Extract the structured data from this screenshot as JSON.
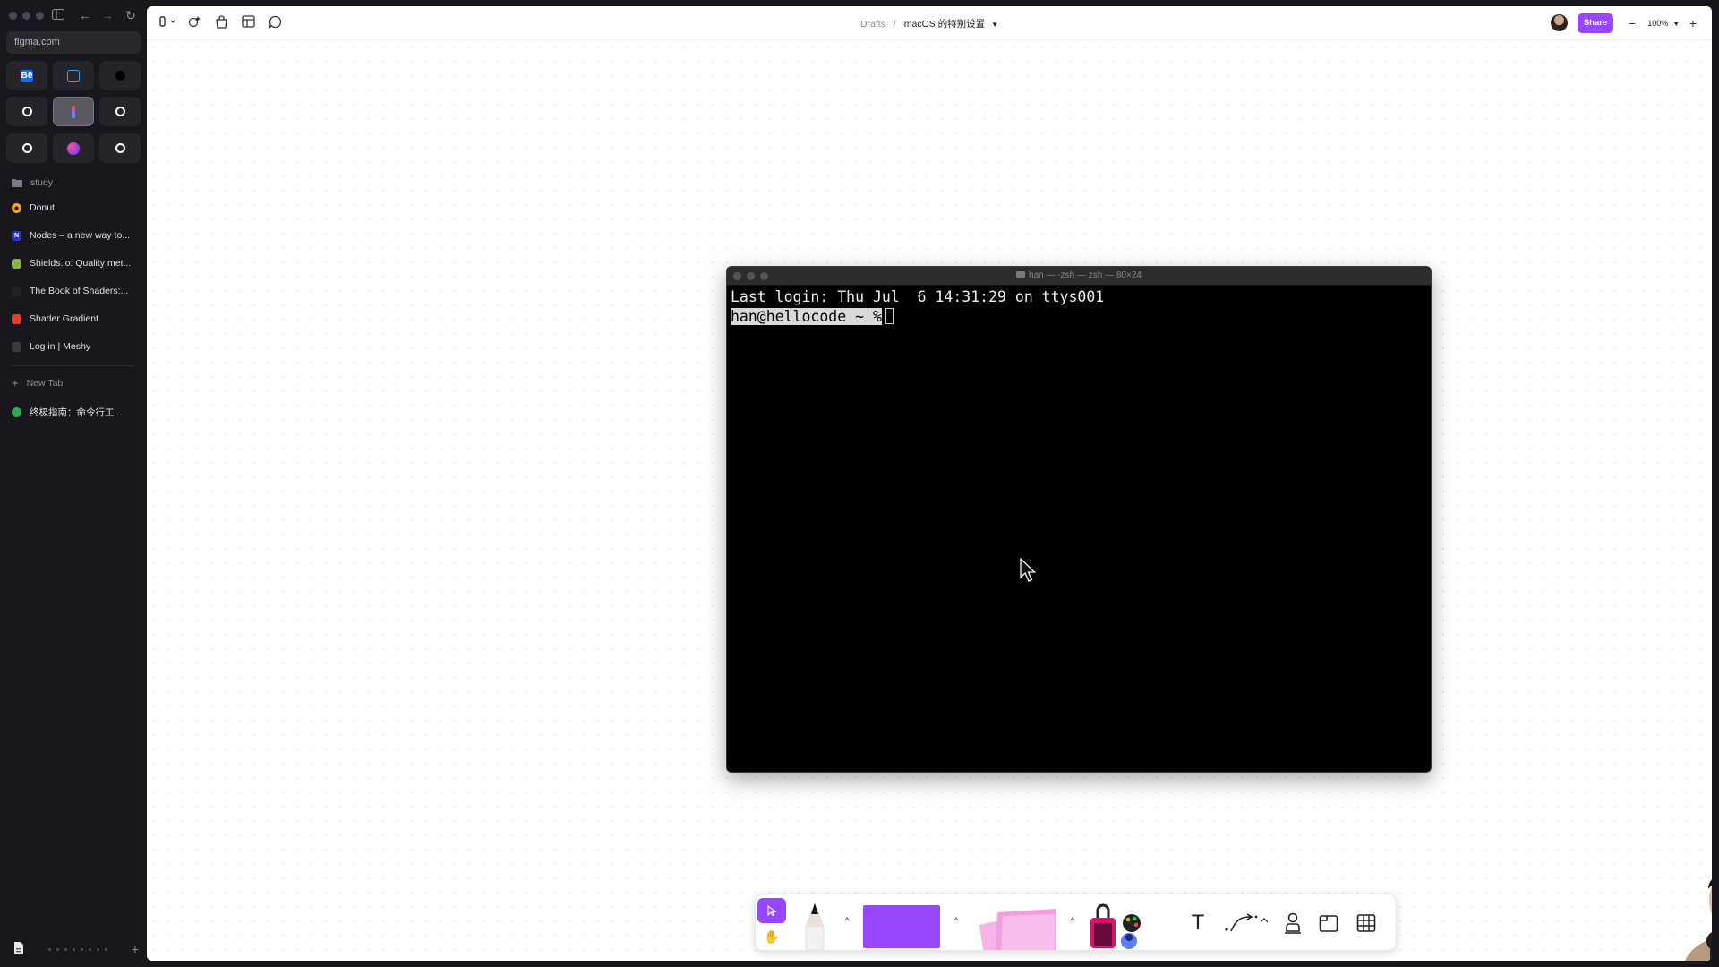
{
  "browser": {
    "url": "figma.com",
    "favorites": [
      {
        "icon": "behance-icon",
        "label": "Bē",
        "color": "#1769ff"
      },
      {
        "icon": "calendar-icon",
        "label": "",
        "color": "#3aa0ff"
      },
      {
        "icon": "circle-app-icon",
        "label": "",
        "color": "#000000"
      },
      {
        "icon": "github-icon",
        "label": "",
        "color": "#ffffff"
      },
      {
        "icon": "figma-icon",
        "label": "",
        "color": "#a259ff"
      },
      {
        "icon": "bear-icon",
        "label": "",
        "color": "#ffffff"
      },
      {
        "icon": "framer-icon",
        "label": "",
        "color": "#ffffff"
      },
      {
        "icon": "gradient-orb-icon",
        "label": "",
        "color": "#7b4dff"
      },
      {
        "icon": "chatgpt-icon",
        "label": "",
        "color": "#ffffff"
      }
    ],
    "folder": "study",
    "tabs": [
      {
        "label": "Donut",
        "icon": "donut-icon",
        "color": "#f5a623"
      },
      {
        "label": "Nodes – a new way to...",
        "icon": "nodes-icon",
        "color": "#2a36c9"
      },
      {
        "label": "Shields.io: Quality met...",
        "icon": "shields-icon",
        "color": "#88b04b"
      },
      {
        "label": "The Book of Shaders:...",
        "icon": "book-of-shaders-icon",
        "color": "#222222"
      },
      {
        "label": "Shader Gradient",
        "icon": "shader-gradient-icon",
        "color": "#e53b2c"
      },
      {
        "label": "Log in | Meshy",
        "icon": "meshy-icon",
        "color": "#3b3b3b"
      }
    ],
    "new_tab_label": "New Tab",
    "extra_tab": {
      "label": "终极指南：命令行工...",
      "icon": "wechat-icon",
      "color": "#2bad4a"
    }
  },
  "figma": {
    "breadcrumb_root": "Drafts",
    "breadcrumb_sep": "/",
    "file_name": "macOS 的特别设置",
    "share_label": "Share",
    "zoom": "100%",
    "accent": "#9747ff"
  },
  "terminal": {
    "title": "han — -zsh — zsh — 80×24",
    "line1": "Last login: Thu Jul  6 14:31:29 on ttys001",
    "prompt": "han@hellocode ~ %"
  },
  "toolbar": {
    "tools": [
      "move-tool",
      "hand-tool",
      "pencil-tool",
      "shape-tool",
      "sticky-tool",
      "stamp-tool",
      "text-tool",
      "connector-tool",
      "stamp-person-tool",
      "section-tool",
      "table-tool"
    ]
  },
  "help_label": "?"
}
